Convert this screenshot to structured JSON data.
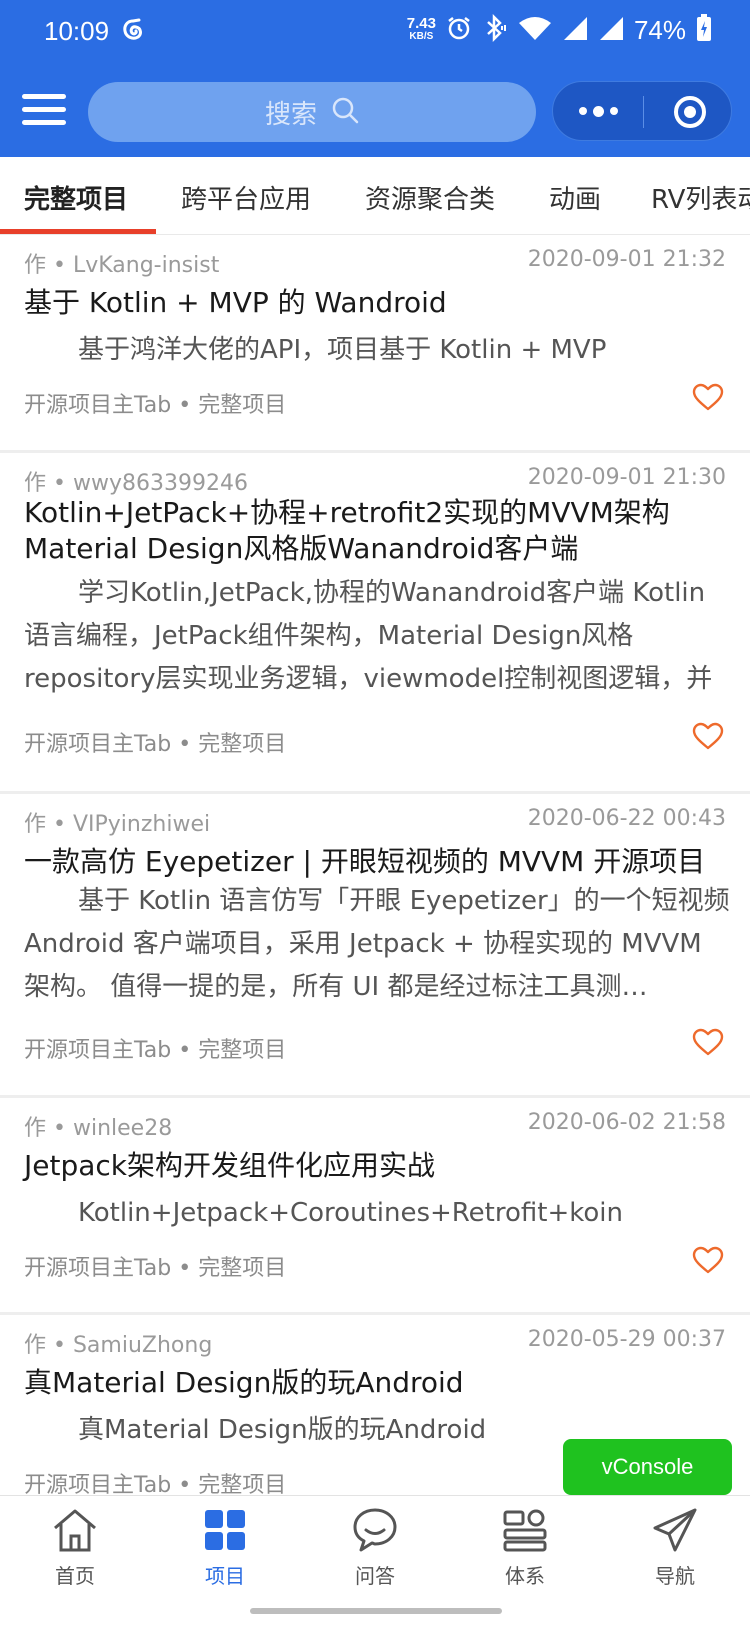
{
  "status_bar": {
    "time": "10:09",
    "net_speed_value": "7.43",
    "net_speed_unit": "KB/S",
    "battery": "74%"
  },
  "header": {
    "search_placeholder": "搜索"
  },
  "tabs": [
    {
      "label": "完整项目",
      "active": true
    },
    {
      "label": "跨平台应用",
      "active": false
    },
    {
      "label": "资源聚合类",
      "active": false
    },
    {
      "label": "动画",
      "active": false
    },
    {
      "label": "RV列表动",
      "active": false
    }
  ],
  "articles": [
    {
      "author": "作 • LvKang-insist",
      "date": "2020-09-01 21:32",
      "title": "基于 Kotlin + MVP 的 Wandroid",
      "desc": "基于鸿洋大佬的API，项目基于 Kotlin + MVP",
      "tags": "开源项目主Tab • 完整项目"
    },
    {
      "author": "作 • wwy863399246",
      "date": "2020-09-01 21:30",
      "title": "Kotlin+JetPack+协程+retrofit2实现的MVVM架构Material Design风格版Wanandroid客户端",
      "desc": "学习Kotlin,JetPack,协程的Wanandroid客户端 Kotlin语言编程，JetPack组件架构，Material Design风格 repository层实现业务逻辑，viewmodel控制视图逻辑，并用…",
      "tags": "开源项目主Tab • 完整项目"
    },
    {
      "author": "作 • VIPyinzhiwei",
      "date": "2020-06-22 00:43",
      "title": "一款高仿 Eyepetizer | 开眼短视频的 MVVM 开源项目",
      "desc": "基于 Kotlin 语言仿写「开眼 Eyepetizer」的一个短视频 Android 客户端项目，采用 Jetpack + 协程实现的 MVVM 架构。 值得一提的是，所有 UI 都是经过标注工具测…",
      "tags": "开源项目主Tab • 完整项目"
    },
    {
      "author": "作 • winlee28",
      "date": "2020-06-02 21:58",
      "title": "Jetpack架构开发组件化应用实战",
      "desc": "Kotlin+Jetpack+Coroutines+Retrofit+koin",
      "tags": "开源项目主Tab • 完整项目"
    },
    {
      "author": "作 • SamiuZhong",
      "date": "2020-05-29 00:37",
      "title": "真Material Design版的玩Android",
      "desc": "真Material Design版的玩Android",
      "tags": "开源项目主Tab • 完整项目"
    }
  ],
  "vconsole_label": "vConsole",
  "bottom_nav": [
    {
      "label": "首页",
      "icon": "home-icon",
      "active": false
    },
    {
      "label": "项目",
      "icon": "grid-icon",
      "active": true
    },
    {
      "label": "问答",
      "icon": "chat-icon",
      "active": false
    },
    {
      "label": "体系",
      "icon": "system-icon",
      "active": false
    },
    {
      "label": "导航",
      "icon": "paper-plane-icon",
      "active": false
    }
  ],
  "colors": {
    "primary": "#2b6de3",
    "accent_underline": "#e8402a",
    "favorite": "#ee6a2c",
    "vconsole": "#1fc21f"
  }
}
